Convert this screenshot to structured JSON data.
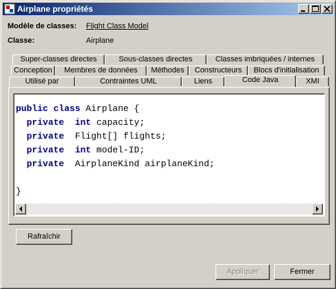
{
  "window": {
    "title": "Airplane propriétés"
  },
  "info": {
    "model_label": "Modèle de classes:",
    "model_value": "Flight Class Model",
    "class_label": "Classe:",
    "class_value": "Airplane"
  },
  "tabs": {
    "row1": [
      "Super-classes directes",
      "Sous-classes directes",
      "Classes imbriquées / internes"
    ],
    "row2": [
      "Conception",
      "Membres de données",
      "Méthodes",
      "Constructeurs",
      "Blocs d'initialisation"
    ],
    "row3": [
      "Utilisé par",
      "Contraintes UML",
      "Liens",
      "Code Java",
      "XMI"
    ],
    "active": "Code Java"
  },
  "code": {
    "line1_kw": "public class",
    "line1_rest": " Airplane {",
    "fields": [
      {
        "modifier": "private",
        "type": "int",
        "type_is_keyword": true,
        "name": "capacity;"
      },
      {
        "modifier": "private",
        "type": "Flight[]",
        "type_is_keyword": false,
        "name": "flights;"
      },
      {
        "modifier": "private",
        "type": "int",
        "type_is_keyword": true,
        "name": "model-ID;"
      },
      {
        "modifier": "private",
        "type": "AirplaneKind",
        "type_is_keyword": false,
        "name": "airplaneKind;"
      }
    ],
    "closing": "}"
  },
  "buttons": {
    "refresh": "Rafraîchir",
    "apply": "Appliquer",
    "close": "Fermer"
  },
  "colors": {
    "title_start": "#0a246a",
    "title_end": "#a6caf0",
    "keyword": "#000080",
    "face": "#d4d0c8"
  }
}
